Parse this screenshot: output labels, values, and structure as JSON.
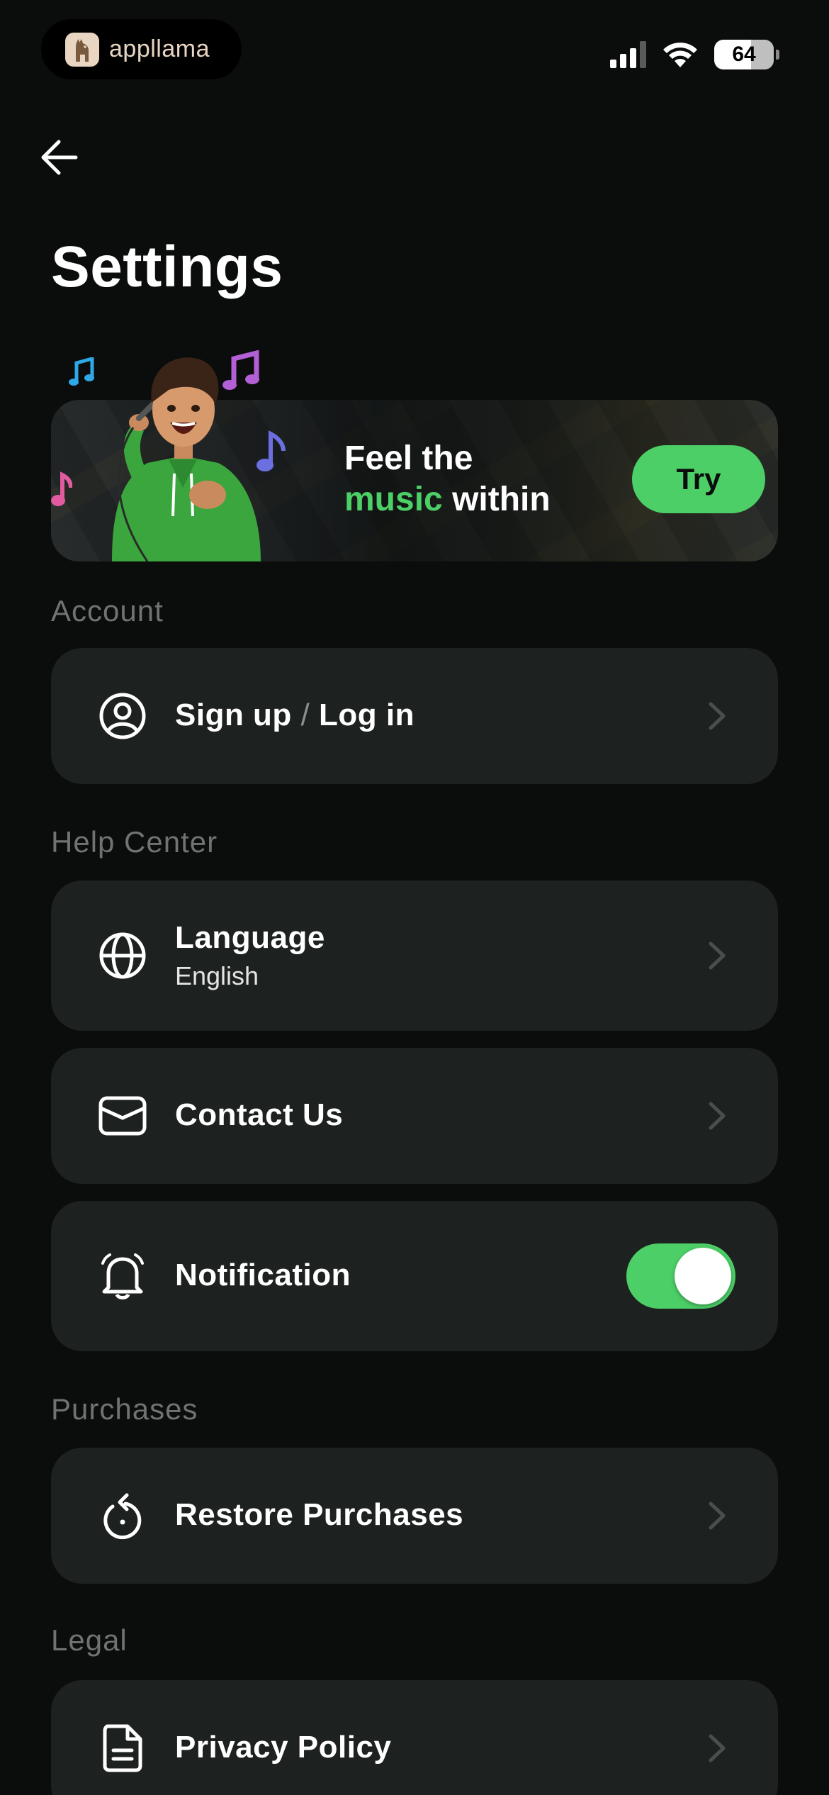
{
  "status_bar": {
    "app_badge_name": "appllama",
    "battery_level": "64"
  },
  "header": {
    "title": "Settings"
  },
  "banner": {
    "line1": "Feel the",
    "line2_accent": "music",
    "line2_rest": "within",
    "cta_label": "Try"
  },
  "sections": {
    "account": {
      "label": "Account",
      "signup_label": "Sign up",
      "separator": "/",
      "login_label": "Log in"
    },
    "help_center": {
      "label": "Help Center",
      "language_label": "Language",
      "language_value": "English",
      "contact_label": "Contact Us",
      "notification_label": "Notification",
      "notification_on": true
    },
    "purchases": {
      "label": "Purchases",
      "restore_label": "Restore Purchases"
    },
    "legal": {
      "label": "Legal",
      "privacy_label": "Privacy Policy"
    }
  },
  "colors": {
    "accent": "#4ccf67",
    "background": "#0b0c0c",
    "card": "#1d2120",
    "section_label": "#6f7373"
  }
}
